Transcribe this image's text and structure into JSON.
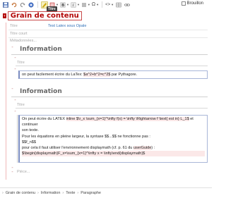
{
  "toolbar": {
    "buttons": [
      "save-icon",
      "undo-icon",
      "redo-icon",
      "insert-icon",
      "highlight-icon",
      "style-icon",
      "bold-icon",
      "italic-icon",
      "list-icon",
      "omega-icon",
      "code-icon",
      "table-icon",
      "link-icon"
    ],
    "omega_label": "Ω",
    "code_label": "<>",
    "brouillon_label": "Brouillon",
    "tooltip": "Titre"
  },
  "document": {
    "title_tag": "T",
    "title": "Grain de contenu"
  },
  "meta": {
    "titre_label": "Titre",
    "titre_value": "Test Latex sous Opale",
    "titre_court_label": "Titre court",
    "metadonnees_label": "Métadonnées..."
  },
  "sections": [
    {
      "title": "Information",
      "titre_label": "Titre",
      "paragraph": {
        "prefix": "on peut facilement écrire du ",
        "latex_word": "LaTex",
        "mid": ": ",
        "formula": "$a^2+b^2=c^2$",
        "suffix": " par Pythagore."
      }
    },
    {
      "title": "Information",
      "titre_label": "Titre",
      "paragraph": {
        "line1_pre": "On peut écrire du LATEX ",
        "line1_inline": "inline",
        "line1_mid": " $\\r_x \\sum_{x=1}^\\infty f(x) = \\infty \\Rightarrow f \\text{ est in} L_1$",
        "line1_post": " et continuer",
        "line2": "son texte.",
        "line3": "Pour les équations en pleine largeur, la syntaxe $$...$$ ne fonctionne pas :",
        "line4": "$$f_n$$",
        "line5_pre": "pour cela il faut utiliser l'environnement displaymath (cf. p. 61 du ",
        "line5_link": "userGuide",
        "line5_post": ") :",
        "line6": "$\\begin{displaymath}F_x=\\sum_{x=1}^\\infty x = \\infty\\end{displaymath}$"
      }
    }
  ],
  "footer_field": "Pièce...",
  "statusbar": [
    "Grain de contenu",
    "Information",
    "Texte",
    "Paragraphe"
  ],
  "colors": {
    "accent": "#b30606",
    "link": "#3070b8",
    "paragraph_border": "#a9b6d8"
  }
}
